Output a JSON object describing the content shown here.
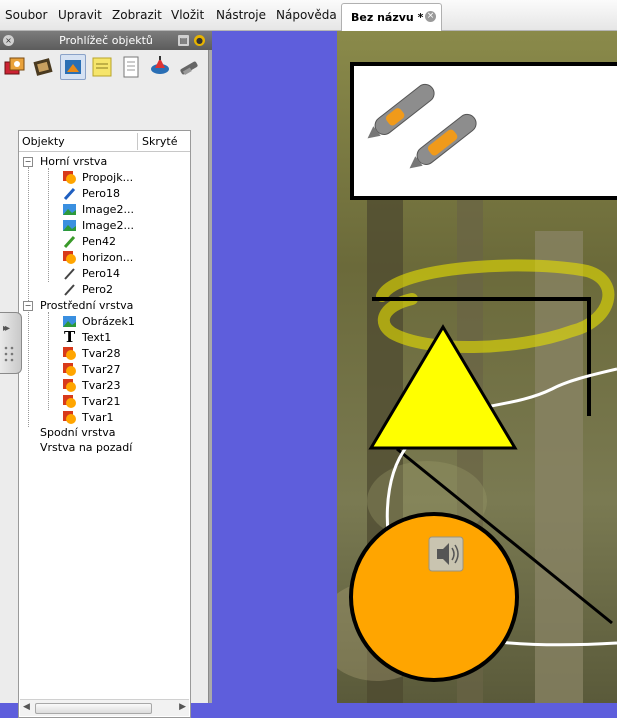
{
  "menu": {
    "items": [
      "Soubor",
      "Upravit",
      "Zobrazit",
      "Vložit",
      "Nástroje",
      "Nápověda"
    ]
  },
  "document_tab": {
    "label": "Bez názvu *"
  },
  "panel": {
    "title": "Prohlížeč objektů",
    "toolbar_icons": [
      "gallery-icon",
      "film-icon",
      "object-browser-icon",
      "notes-icon",
      "page-sorter-icon",
      "spinner-icon",
      "pen-tool-icon"
    ],
    "tree": {
      "columns": [
        "Objekty",
        "Skryté"
      ],
      "layers": [
        {
          "name": "Horní vrstva",
          "items": [
            {
              "label": "Propojk...",
              "icon": "shape-icon"
            },
            {
              "label": "Pero18",
              "icon": "pen-icon"
            },
            {
              "label": "Image2...",
              "icon": "image-icon"
            },
            {
              "label": "Image2...",
              "icon": "image-icon"
            },
            {
              "label": "Pen42",
              "icon": "highlighter-icon"
            },
            {
              "label": "horizon...",
              "icon": "shape-icon"
            },
            {
              "label": "Pero14",
              "icon": "pen-icon"
            },
            {
              "label": "Pero2",
              "icon": "pen-icon"
            }
          ]
        },
        {
          "name": "Prostřední vrstva",
          "items": [
            {
              "label": "Obrázek1",
              "icon": "image-icon"
            },
            {
              "label": "Text1",
              "icon": "text-icon"
            },
            {
              "label": "Tvar28",
              "icon": "shape-icon"
            },
            {
              "label": "Tvar27",
              "icon": "shape-icon"
            },
            {
              "label": "Tvar23",
              "icon": "shape-icon"
            },
            {
              "label": "Tvar21",
              "icon": "shape-icon"
            },
            {
              "label": "Tvar1",
              "icon": "shape-icon"
            }
          ]
        },
        {
          "name": "Spodní vrstva",
          "items": []
        },
        {
          "name": "Vrstva na pozadí",
          "items": []
        }
      ]
    }
  },
  "canvas": {
    "speaker_icon": "speaker-icon",
    "colors": {
      "background_workspace": "#5e5edc",
      "triangle": "#ffff00",
      "circle": "#ffa500",
      "highlight_stroke": "#e6e000"
    }
  }
}
